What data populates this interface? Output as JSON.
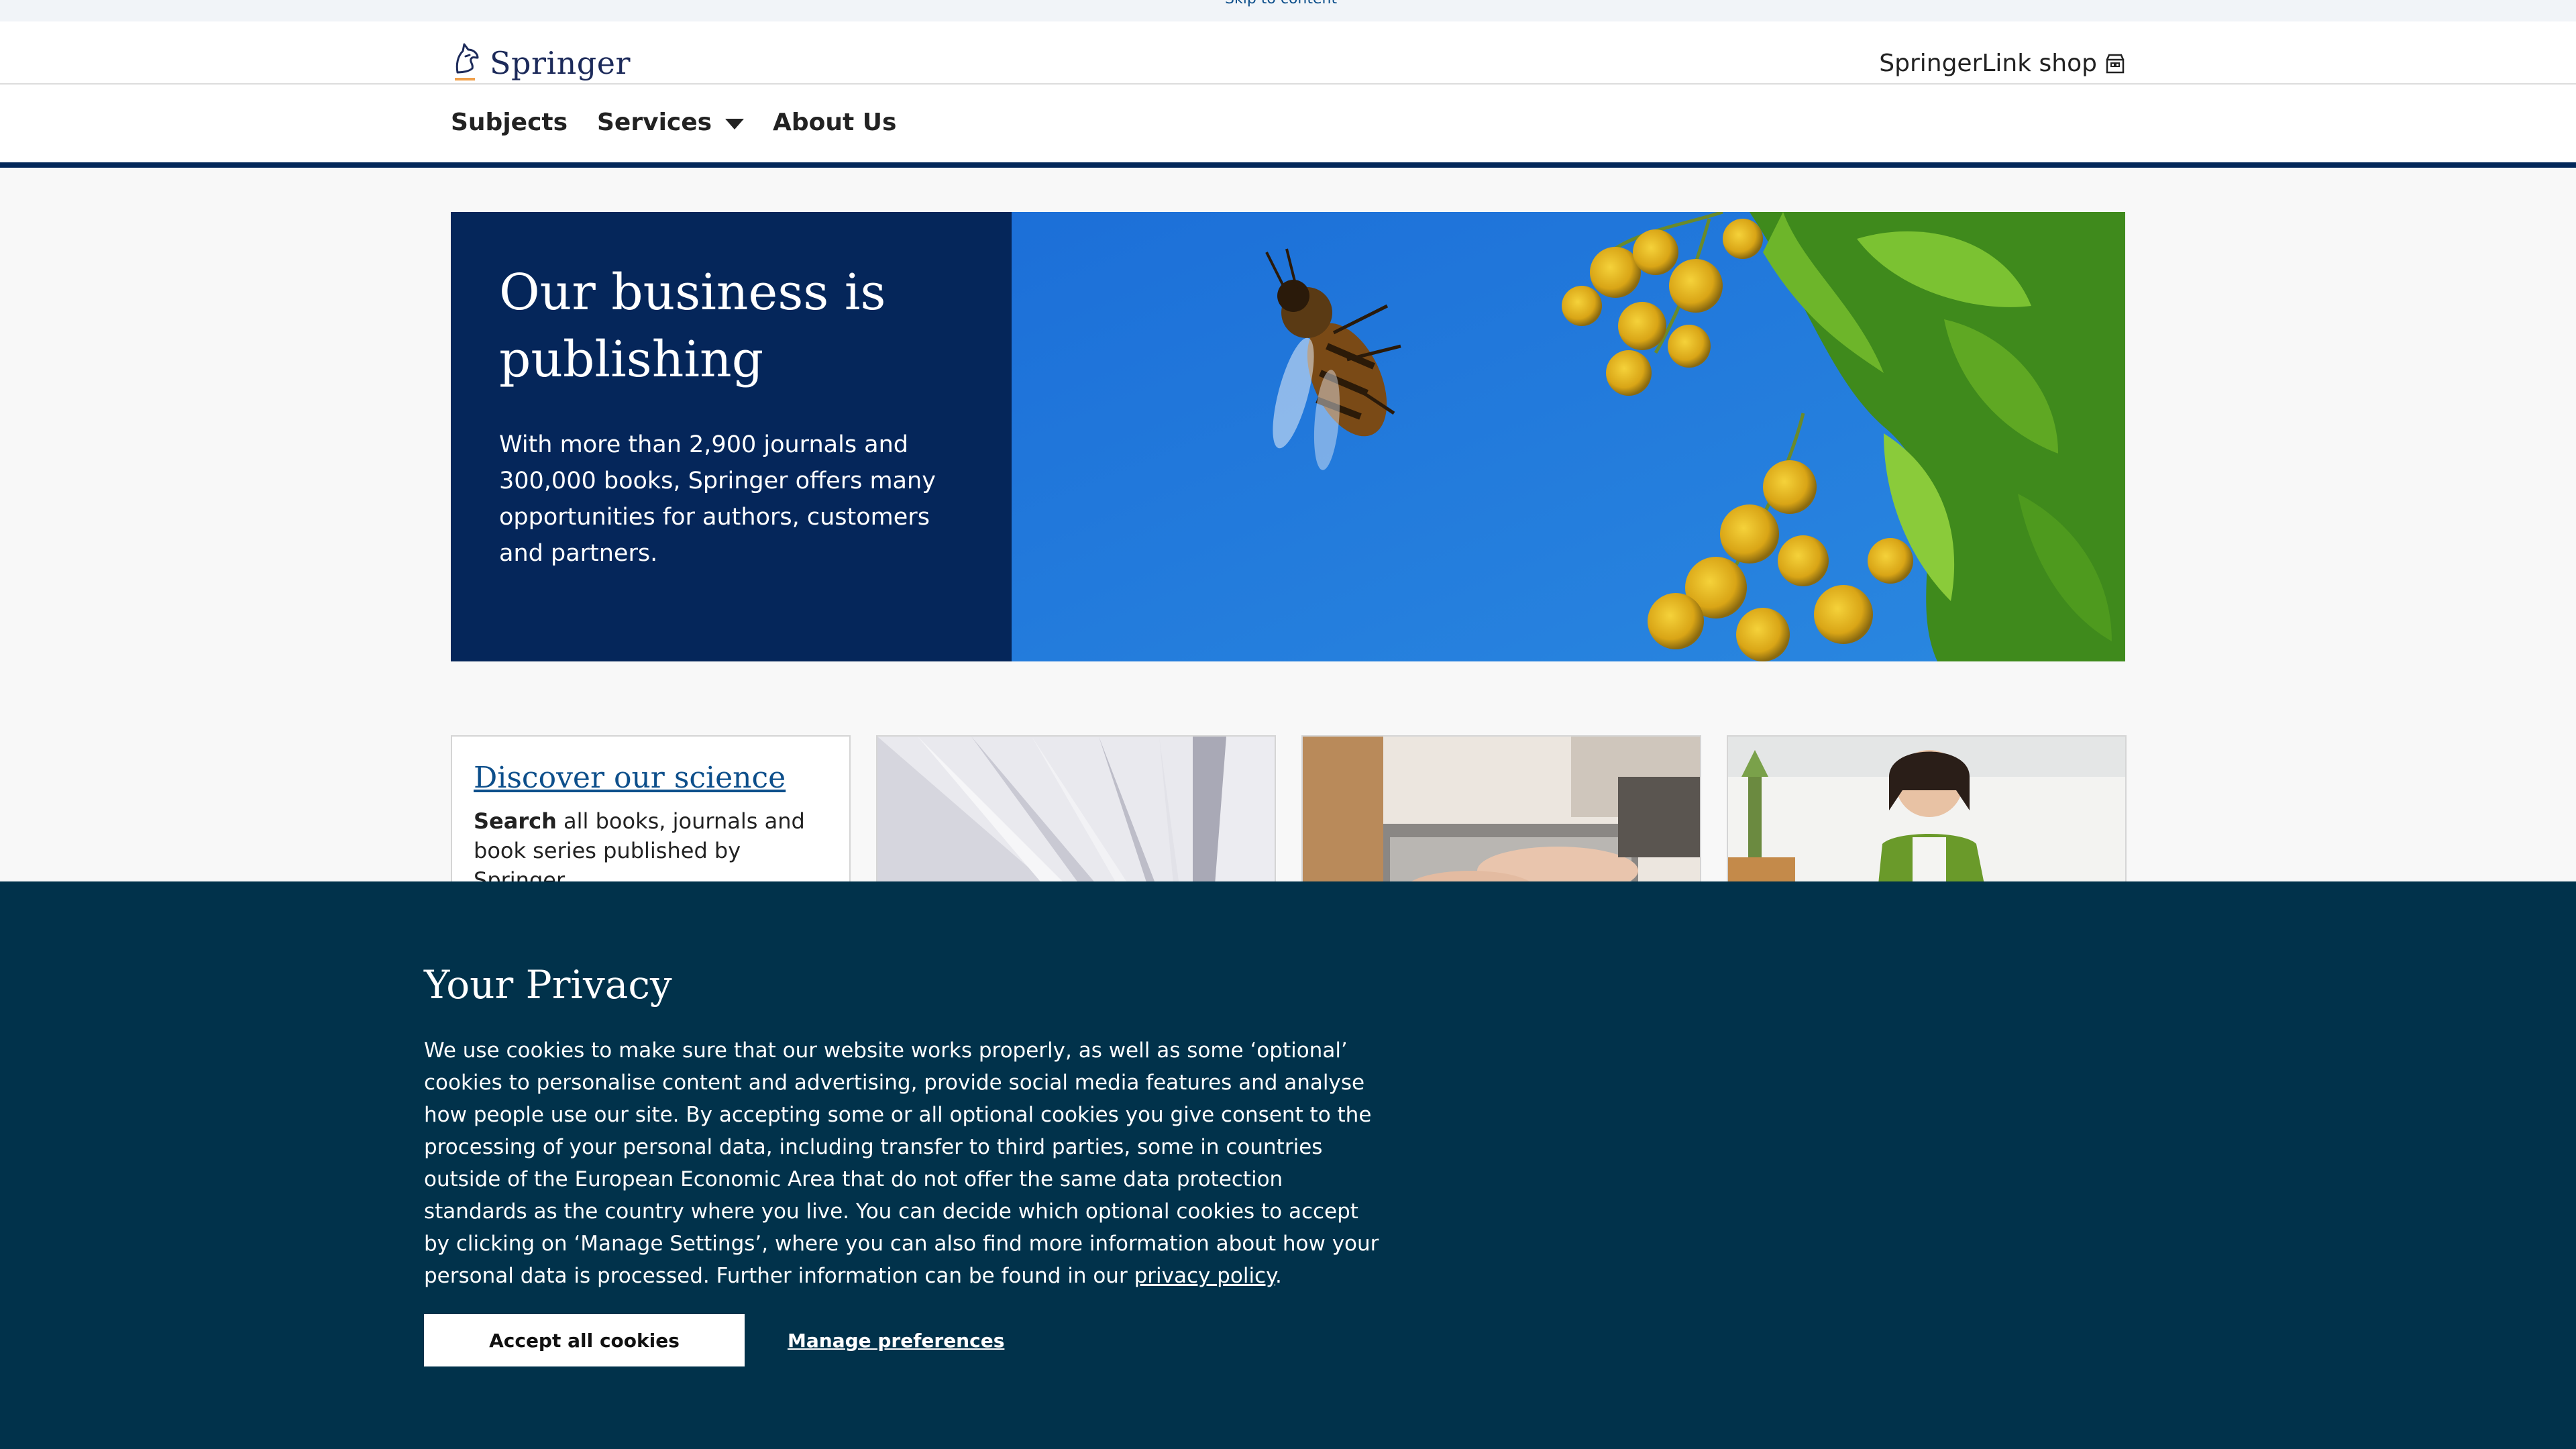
{
  "skip_link": "Skip to content",
  "header": {
    "logo_text": "Springer",
    "shop_label": "SpringerLink shop"
  },
  "nav": {
    "items": [
      "Subjects",
      "Services",
      "About Us"
    ]
  },
  "hero": {
    "title": "Our business is publishing",
    "text": "With more than 2,900 journals and 300,000 books, Springer offers many opportunities for authors, customers and partners."
  },
  "cards": {
    "discover_title": "Discover our science",
    "discover_text_bold": "Search",
    "discover_text_rest": " all books, journals and book series published by Springer"
  },
  "privacy": {
    "title": "Your Privacy",
    "text": "We use cookies to make sure that our website works properly, as well as some ‘optional’ cookies to personalise content and advertising, provide social media features and analyse how people use our site. By accepting some or all optional cookies you give consent to the processing of your personal data, including transfer to third parties, some in countries outside of the European Economic Area that do not offer the same data protection standards as the country where you live. You can decide which optional cookies to accept by clicking on ‘Manage Settings’, where you can also find more information about how your personal data is processed. Further information can be found in our ",
    "policy_link": "privacy policy",
    "text_end": ".",
    "accept_label": "Accept all cookies",
    "manage_label": "Manage preferences"
  },
  "colors": {
    "brand_navy": "#05265a",
    "privacy_bg": "#01324b",
    "link_blue": "#0d4f8b",
    "accent_orange": "#f0a04b"
  },
  "icons": [
    "springer-horse-icon",
    "shop-icon",
    "chevron-down-icon"
  ]
}
